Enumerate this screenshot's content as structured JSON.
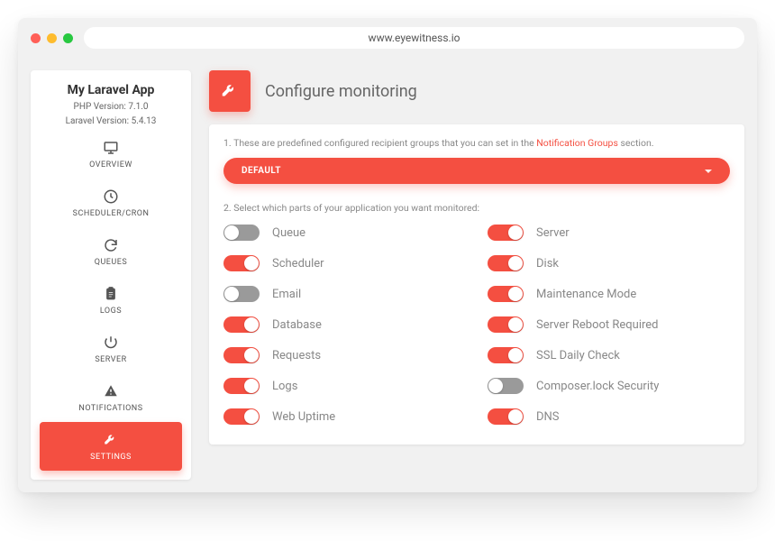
{
  "browser": {
    "url": "www.eyewitness.io"
  },
  "sidebar": {
    "app_name": "My Laravel App",
    "php_version": "PHP Version: 7.1.0",
    "laravel_version": "Laravel Version: 5.4.13",
    "items": [
      {
        "label": "OVERVIEW",
        "icon": "monitor-icon"
      },
      {
        "label": "SCHEDULER/CRON",
        "icon": "clock-icon"
      },
      {
        "label": "QUEUES",
        "icon": "refresh-icon"
      },
      {
        "label": "LOGS",
        "icon": "clipboard-icon"
      },
      {
        "label": "SERVER",
        "icon": "power-icon"
      },
      {
        "label": "NOTIFICATIONS",
        "icon": "alert-icon"
      },
      {
        "label": "SETTINGS",
        "icon": "wrench-icon"
      }
    ]
  },
  "page": {
    "title": "Configure monitoring",
    "step1_prefix": "1. These are predefined configured recipient groups that you can set in the ",
    "step1_link": "Notification Groups",
    "step1_suffix": " section.",
    "dropdown_value": "DEFAULT",
    "step2": "2. Select which parts of your application you want monitored:"
  },
  "toggles_left": [
    {
      "label": "Queue",
      "on": false
    },
    {
      "label": "Scheduler",
      "on": true
    },
    {
      "label": "Email",
      "on": false
    },
    {
      "label": "Database",
      "on": true
    },
    {
      "label": "Requests",
      "on": true
    },
    {
      "label": "Logs",
      "on": true
    },
    {
      "label": "Web Uptime",
      "on": true
    }
  ],
  "toggles_right": [
    {
      "label": "Server",
      "on": true
    },
    {
      "label": "Disk",
      "on": true
    },
    {
      "label": "Maintenance Mode",
      "on": true
    },
    {
      "label": "Server Reboot Required",
      "on": true
    },
    {
      "label": "SSL Daily Check",
      "on": true
    },
    {
      "label": "Composer.lock Security",
      "on": false
    },
    {
      "label": "DNS",
      "on": true
    }
  ]
}
